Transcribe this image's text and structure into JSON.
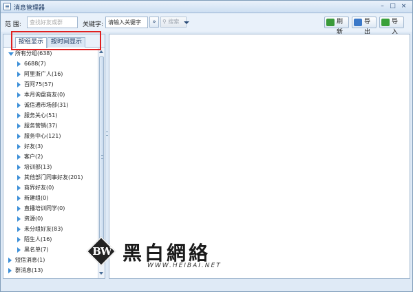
{
  "window": {
    "title": "消息管理器",
    "minimize": "–",
    "maximize": "□",
    "close": "×"
  },
  "toolbar": {
    "scope_label": "范  围:",
    "scope_placeholder": "查找好友或群",
    "keyword_label": "关键字:",
    "keyword_value": "请输入关键字",
    "more_glyph": "»",
    "search_label": "搜索",
    "refresh_label": "刷新",
    "export_label": "导出",
    "import_label": "导入"
  },
  "tabs": [
    {
      "label": "按组显示",
      "active": true
    },
    {
      "label": "按时间显示",
      "active": false
    }
  ],
  "tree": {
    "root": {
      "label": "所有分组",
      "count": "(638)"
    },
    "groups": [
      {
        "label": "6688",
        "count": "(7)"
      },
      {
        "label": "阿里浙广人",
        "count": "(16)"
      },
      {
        "label": "百阿75",
        "count": "(57)"
      },
      {
        "label": "本月询盘商友",
        "count": "(0)"
      },
      {
        "label": "诚信通市场部",
        "count": "(31)"
      },
      {
        "label": "服务关心",
        "count": "(51)"
      },
      {
        "label": "服务营销",
        "count": "(37)"
      },
      {
        "label": "服务中心",
        "count": "(121)"
      },
      {
        "label": "好友",
        "count": "(3)"
      },
      {
        "label": "客户",
        "count": "(2)"
      },
      {
        "label": "培训部",
        "count": "(13)"
      },
      {
        "label": "其他部门同事好友",
        "count": "(201)"
      },
      {
        "label": "商界好友",
        "count": "(0)"
      },
      {
        "label": "新建组",
        "count": "(0)"
      },
      {
        "label": "直播培训同学",
        "count": "(0)"
      },
      {
        "label": "资源",
        "count": "(0)"
      },
      {
        "label": "未分组好友",
        "count": "(83)"
      },
      {
        "label": "陌生人",
        "count": "(16)"
      },
      {
        "label": "黑名单",
        "count": "(7)"
      }
    ],
    "others": [
      {
        "label": "短信消息",
        "count": "(1)"
      },
      {
        "label": "群消息",
        "count": "(13)"
      }
    ]
  },
  "watermark": {
    "logo_text": "BW",
    "name": "黑白網絡",
    "url": "WWW.HEIBAI.NET"
  },
  "colors": {
    "accent": "#3c8fd8",
    "highlight": "#e02020"
  }
}
